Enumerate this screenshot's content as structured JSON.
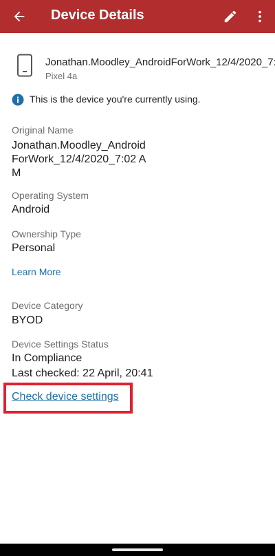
{
  "appbar": {
    "title": "Device Details",
    "back_icon": "arrow-left-icon",
    "edit_icon": "pencil-icon",
    "more_icon": "more-vertical-icon",
    "background_color": "#b22d2d"
  },
  "device": {
    "icon": "smartphone-icon",
    "name": "Jonathan.Moodley_AndroidForWork_12/4/2020_7:02 AM",
    "model": "Pixel 4a"
  },
  "info": {
    "icon": "info-icon",
    "text": "This is the device you're currently using."
  },
  "details": {
    "original_name_label": "Original Name",
    "original_name_value": "Jonathan.Moodley_AndroidForWork_12/4/2020_7:02 AM",
    "os_label": "Operating System",
    "os_value": "Android",
    "ownership_label": "Ownership Type",
    "ownership_value": "Personal",
    "learn_more": "Learn More",
    "category_label": "Device Category",
    "category_value": "BYOD",
    "settings_status_label": "Device Settings Status",
    "settings_status_value": "In Compliance",
    "last_checked": "Last checked: 22 April, 20:41",
    "check_link": "Check device settings"
  },
  "colors": {
    "link": "#1f6fa8",
    "highlight": "#e0202f"
  }
}
